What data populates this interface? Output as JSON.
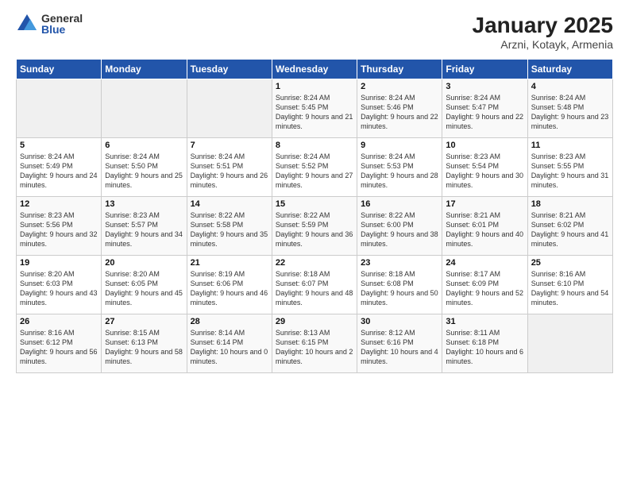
{
  "logo": {
    "general": "General",
    "blue": "Blue"
  },
  "header": {
    "title": "January 2025",
    "subtitle": "Arzni, Kotayk, Armenia"
  },
  "weekdays": [
    "Sunday",
    "Monday",
    "Tuesday",
    "Wednesday",
    "Thursday",
    "Friday",
    "Saturday"
  ],
  "weeks": [
    [
      {
        "day": "",
        "sunrise": "",
        "sunset": "",
        "daylight": ""
      },
      {
        "day": "",
        "sunrise": "",
        "sunset": "",
        "daylight": ""
      },
      {
        "day": "",
        "sunrise": "",
        "sunset": "",
        "daylight": ""
      },
      {
        "day": "1",
        "sunrise": "Sunrise: 8:24 AM",
        "sunset": "Sunset: 5:45 PM",
        "daylight": "Daylight: 9 hours and 21 minutes."
      },
      {
        "day": "2",
        "sunrise": "Sunrise: 8:24 AM",
        "sunset": "Sunset: 5:46 PM",
        "daylight": "Daylight: 9 hours and 22 minutes."
      },
      {
        "day": "3",
        "sunrise": "Sunrise: 8:24 AM",
        "sunset": "Sunset: 5:47 PM",
        "daylight": "Daylight: 9 hours and 22 minutes."
      },
      {
        "day": "4",
        "sunrise": "Sunrise: 8:24 AM",
        "sunset": "Sunset: 5:48 PM",
        "daylight": "Daylight: 9 hours and 23 minutes."
      }
    ],
    [
      {
        "day": "5",
        "sunrise": "Sunrise: 8:24 AM",
        "sunset": "Sunset: 5:49 PM",
        "daylight": "Daylight: 9 hours and 24 minutes."
      },
      {
        "day": "6",
        "sunrise": "Sunrise: 8:24 AM",
        "sunset": "Sunset: 5:50 PM",
        "daylight": "Daylight: 9 hours and 25 minutes."
      },
      {
        "day": "7",
        "sunrise": "Sunrise: 8:24 AM",
        "sunset": "Sunset: 5:51 PM",
        "daylight": "Daylight: 9 hours and 26 minutes."
      },
      {
        "day": "8",
        "sunrise": "Sunrise: 8:24 AM",
        "sunset": "Sunset: 5:52 PM",
        "daylight": "Daylight: 9 hours and 27 minutes."
      },
      {
        "day": "9",
        "sunrise": "Sunrise: 8:24 AM",
        "sunset": "Sunset: 5:53 PM",
        "daylight": "Daylight: 9 hours and 28 minutes."
      },
      {
        "day": "10",
        "sunrise": "Sunrise: 8:23 AM",
        "sunset": "Sunset: 5:54 PM",
        "daylight": "Daylight: 9 hours and 30 minutes."
      },
      {
        "day": "11",
        "sunrise": "Sunrise: 8:23 AM",
        "sunset": "Sunset: 5:55 PM",
        "daylight": "Daylight: 9 hours and 31 minutes."
      }
    ],
    [
      {
        "day": "12",
        "sunrise": "Sunrise: 8:23 AM",
        "sunset": "Sunset: 5:56 PM",
        "daylight": "Daylight: 9 hours and 32 minutes."
      },
      {
        "day": "13",
        "sunrise": "Sunrise: 8:23 AM",
        "sunset": "Sunset: 5:57 PM",
        "daylight": "Daylight: 9 hours and 34 minutes."
      },
      {
        "day": "14",
        "sunrise": "Sunrise: 8:22 AM",
        "sunset": "Sunset: 5:58 PM",
        "daylight": "Daylight: 9 hours and 35 minutes."
      },
      {
        "day": "15",
        "sunrise": "Sunrise: 8:22 AM",
        "sunset": "Sunset: 5:59 PM",
        "daylight": "Daylight: 9 hours and 36 minutes."
      },
      {
        "day": "16",
        "sunrise": "Sunrise: 8:22 AM",
        "sunset": "Sunset: 6:00 PM",
        "daylight": "Daylight: 9 hours and 38 minutes."
      },
      {
        "day": "17",
        "sunrise": "Sunrise: 8:21 AM",
        "sunset": "Sunset: 6:01 PM",
        "daylight": "Daylight: 9 hours and 40 minutes."
      },
      {
        "day": "18",
        "sunrise": "Sunrise: 8:21 AM",
        "sunset": "Sunset: 6:02 PM",
        "daylight": "Daylight: 9 hours and 41 minutes."
      }
    ],
    [
      {
        "day": "19",
        "sunrise": "Sunrise: 8:20 AM",
        "sunset": "Sunset: 6:03 PM",
        "daylight": "Daylight: 9 hours and 43 minutes."
      },
      {
        "day": "20",
        "sunrise": "Sunrise: 8:20 AM",
        "sunset": "Sunset: 6:05 PM",
        "daylight": "Daylight: 9 hours and 45 minutes."
      },
      {
        "day": "21",
        "sunrise": "Sunrise: 8:19 AM",
        "sunset": "Sunset: 6:06 PM",
        "daylight": "Daylight: 9 hours and 46 minutes."
      },
      {
        "day": "22",
        "sunrise": "Sunrise: 8:18 AM",
        "sunset": "Sunset: 6:07 PM",
        "daylight": "Daylight: 9 hours and 48 minutes."
      },
      {
        "day": "23",
        "sunrise": "Sunrise: 8:18 AM",
        "sunset": "Sunset: 6:08 PM",
        "daylight": "Daylight: 9 hours and 50 minutes."
      },
      {
        "day": "24",
        "sunrise": "Sunrise: 8:17 AM",
        "sunset": "Sunset: 6:09 PM",
        "daylight": "Daylight: 9 hours and 52 minutes."
      },
      {
        "day": "25",
        "sunrise": "Sunrise: 8:16 AM",
        "sunset": "Sunset: 6:10 PM",
        "daylight": "Daylight: 9 hours and 54 minutes."
      }
    ],
    [
      {
        "day": "26",
        "sunrise": "Sunrise: 8:16 AM",
        "sunset": "Sunset: 6:12 PM",
        "daylight": "Daylight: 9 hours and 56 minutes."
      },
      {
        "day": "27",
        "sunrise": "Sunrise: 8:15 AM",
        "sunset": "Sunset: 6:13 PM",
        "daylight": "Daylight: 9 hours and 58 minutes."
      },
      {
        "day": "28",
        "sunrise": "Sunrise: 8:14 AM",
        "sunset": "Sunset: 6:14 PM",
        "daylight": "Daylight: 10 hours and 0 minutes."
      },
      {
        "day": "29",
        "sunrise": "Sunrise: 8:13 AM",
        "sunset": "Sunset: 6:15 PM",
        "daylight": "Daylight: 10 hours and 2 minutes."
      },
      {
        "day": "30",
        "sunrise": "Sunrise: 8:12 AM",
        "sunset": "Sunset: 6:16 PM",
        "daylight": "Daylight: 10 hours and 4 minutes."
      },
      {
        "day": "31",
        "sunrise": "Sunrise: 8:11 AM",
        "sunset": "Sunset: 6:18 PM",
        "daylight": "Daylight: 10 hours and 6 minutes."
      },
      {
        "day": "",
        "sunrise": "",
        "sunset": "",
        "daylight": ""
      }
    ]
  ]
}
